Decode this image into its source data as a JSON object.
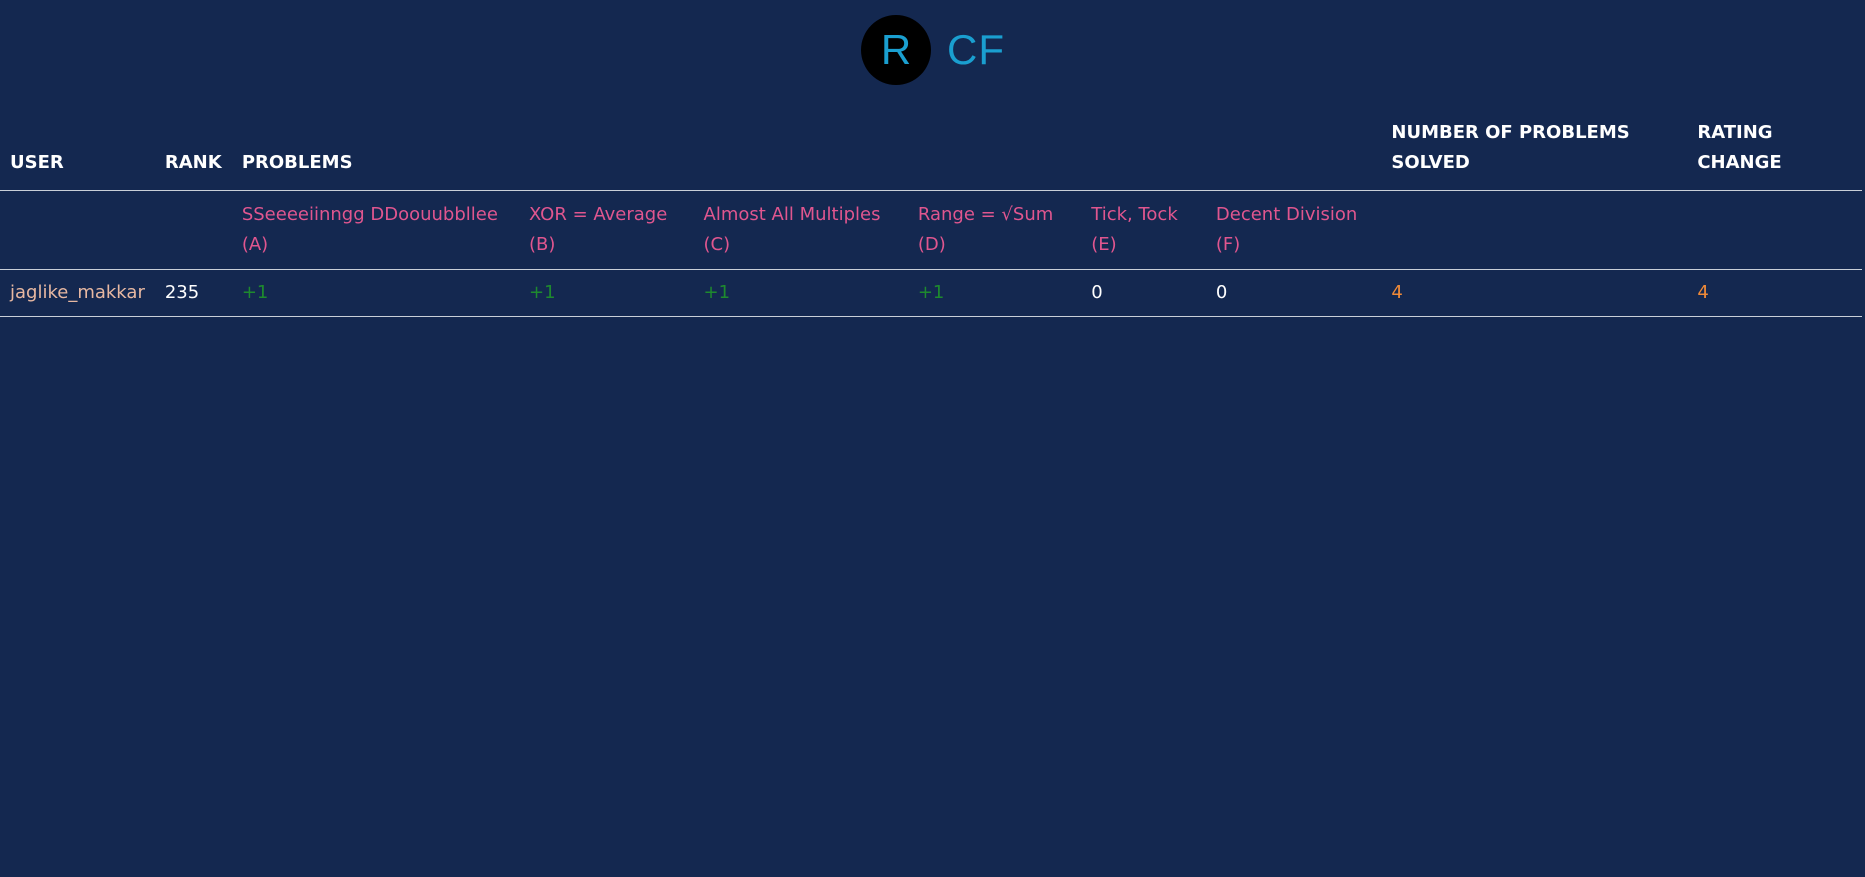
{
  "logo": {
    "initial": "R",
    "text": "CF"
  },
  "colors": {
    "background": "#142850",
    "logo": "#1a9fd0",
    "problem_link": "#e0568f",
    "accepted": "#1e8a2e",
    "highlight": "#f08a38",
    "username": "#e7b8a2"
  },
  "table": {
    "headers": {
      "user": "USER",
      "rank": "RANK",
      "problems": "PROBLEMS",
      "solved_line1": "NUMBER OF PROBLEMS",
      "solved_line2": "SOLVED",
      "rating_line1": "RATING",
      "rating_line2": "CHANGE"
    },
    "problems": [
      {
        "name": "SSeeeeiinngg DDoouubbllee",
        "index": "(A)"
      },
      {
        "name": "XOR = Average",
        "index": "(B)"
      },
      {
        "name": "Almost All Multiples",
        "index": "(C)"
      },
      {
        "name": "Range = √Sum",
        "index": "(D)"
      },
      {
        "name": "Tick, Tock",
        "index": "(E)"
      },
      {
        "name": "Decent Division",
        "index": "(F)"
      }
    ],
    "rows": [
      {
        "user": "jaglike_makkar",
        "rank": "235",
        "results": [
          "+1",
          "+1",
          "+1",
          "+1",
          "0",
          "0"
        ],
        "solved": "4",
        "rating_change": "4"
      }
    ]
  }
}
